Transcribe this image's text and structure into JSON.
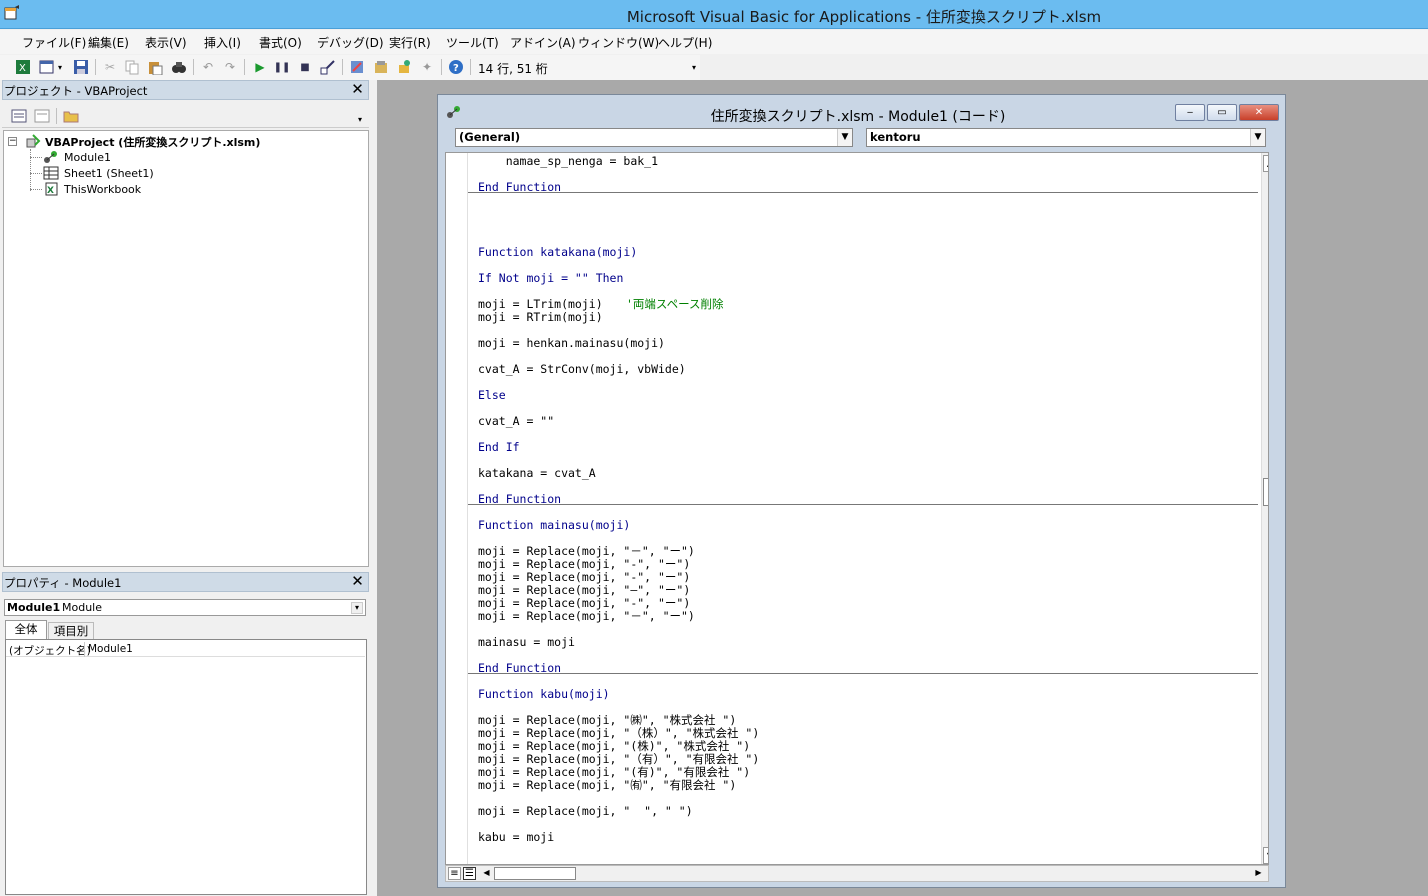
{
  "window": {
    "title": "Microsoft Visual Basic for Applications - 住所変換スクリプト.xlsm"
  },
  "menu": [
    "ファイル(F)",
    "編集(E)",
    "表示(V)",
    "挿入(I)",
    "書式(O)",
    "デバッグ(D)",
    "実行(R)",
    "ツール(T)",
    "アドイン(A)",
    "ウィンドウ(W)",
    "ヘルプ(H)"
  ],
  "toolbar": {
    "cursor_position": "14 行, 51 桁"
  },
  "project_pane": {
    "title": "プロジェクト - VBAProject",
    "root": "VBAProject (住所変換スクリプト.xlsm)",
    "items": [
      "Module1",
      "Sheet1 (Sheet1)",
      "ThisWorkbook"
    ]
  },
  "properties_pane": {
    "title": "プロパティ - Module1",
    "object_name": "Module1",
    "object_type": "Module",
    "tabs": [
      "全体",
      "項目別"
    ],
    "row_label": "(オブジェクト名)",
    "row_value": "Module1"
  },
  "code_window": {
    "title": "住所変換スクリプト.xlsm - Module1 (コード)",
    "object_combo": "(General)",
    "procedure_combo": "kentoru",
    "lines": [
      [
        "    namae_sp_nenga = bak_1",
        ""
      ],
      [
        "End Function",
        "kw"
      ],
      [
        "Function katakana(moji)",
        "kw"
      ],
      [
        "If Not moji = \"\" Then",
        "kw"
      ],
      [
        "moji = LTrim(moji)   ",
        ""
      ],
      [
        "'両端スペース削除",
        "cm"
      ],
      [
        "moji = RTrim(moji)",
        ""
      ],
      [
        "moji = henkan.mainasu(moji)",
        ""
      ],
      [
        "cvat_A = StrConv(moji, vbWide)",
        ""
      ],
      [
        "Else",
        "kw"
      ],
      [
        "cvat_A = \"\"",
        ""
      ],
      [
        "End If",
        "kw"
      ],
      [
        "katakana = cvat_A",
        ""
      ],
      [
        "End Function",
        "kw"
      ],
      [
        "Function mainasu(moji)",
        "kw"
      ],
      [
        "moji = Replace(moji, \"－\", \"ー\")",
        ""
      ],
      [
        "moji = Replace(moji, \"-\", \"ー\")",
        ""
      ],
      [
        "moji = Replace(moji, \"‐\", \"ー\")",
        ""
      ],
      [
        "moji = Replace(moji, \"―\", \"ー\")",
        ""
      ],
      [
        "moji = Replace(moji, \"‑\", \"ー\")",
        ""
      ],
      [
        "moji = Replace(moji, \"－\", \"ー\")",
        ""
      ],
      [
        "mainasu = moji",
        ""
      ],
      [
        "End Function",
        "kw"
      ],
      [
        "Function kabu(moji)",
        "kw"
      ],
      [
        "moji = Replace(moji, \"㈱\", \"株式会社 \")",
        ""
      ],
      [
        "moji = Replace(moji, \"（株）\", \"株式会社 \")",
        ""
      ],
      [
        "moji = Replace(moji, \"(株)\", \"株式会社 \")",
        ""
      ],
      [
        "moji = Replace(moji, \"（有）\", \"有限会社 \")",
        ""
      ],
      [
        "moji = Replace(moji, \"(有)\", \"有限会社 \")",
        ""
      ],
      [
        "moji = Replace(moji, \"㈲\", \"有限会社 \")",
        ""
      ],
      [
        "moji = Replace(moji, \"  \", \" \")",
        ""
      ],
      [
        "kabu = moji",
        ""
      ]
    ]
  }
}
